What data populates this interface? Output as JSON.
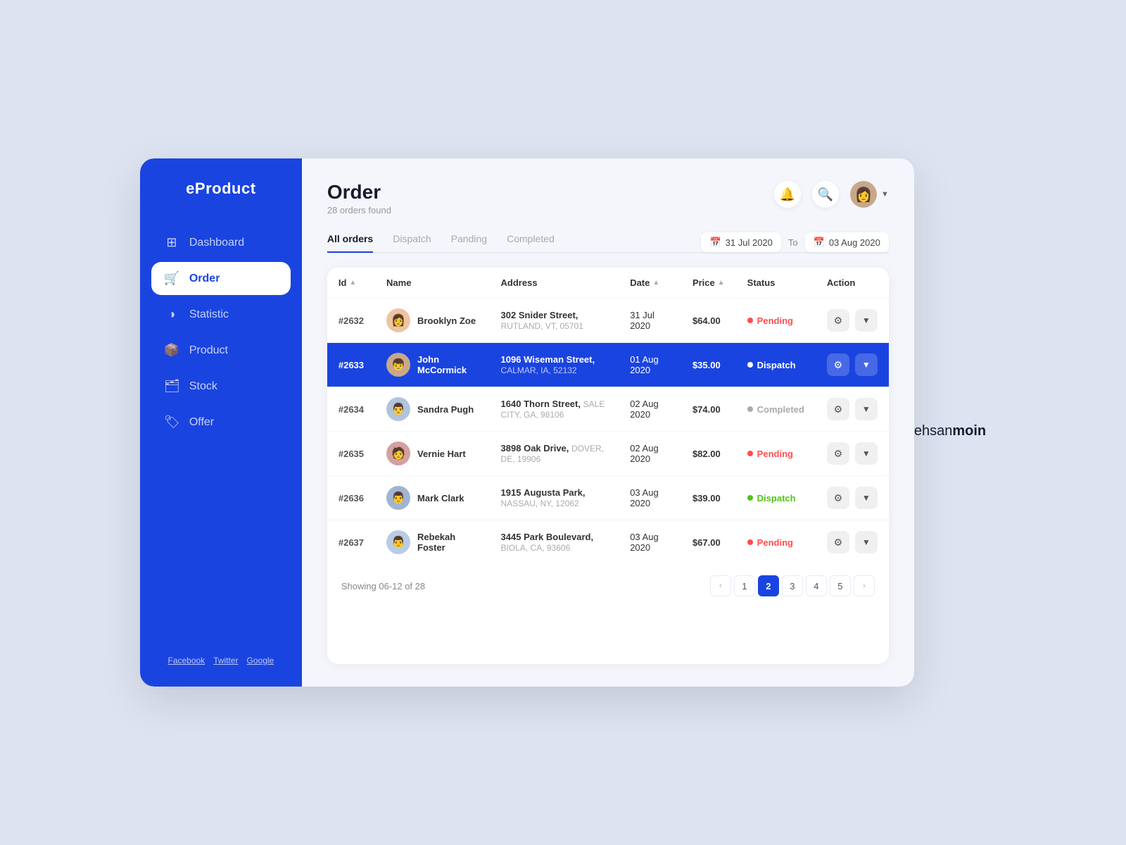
{
  "app": {
    "name": "eProduct"
  },
  "sidebar": {
    "logo": "eProduct",
    "nav_items": [
      {
        "id": "dashboard",
        "label": "Dashboard",
        "icon": "⊞",
        "active": false
      },
      {
        "id": "order",
        "label": "Order",
        "icon": "🛒",
        "active": true
      },
      {
        "id": "statistic",
        "label": "Statistic",
        "icon": "◑",
        "active": false
      },
      {
        "id": "product",
        "label": "Product",
        "icon": "📦",
        "active": false
      },
      {
        "id": "stock",
        "label": "Stock",
        "icon": "🗂",
        "active": false
      },
      {
        "id": "offer",
        "label": "Offer",
        "icon": "🏷",
        "active": false
      }
    ],
    "footer_links": [
      "Facebook",
      "Twitter",
      "Google"
    ]
  },
  "header": {
    "title": "Order",
    "subtitle": "28 orders found",
    "notification_icon": "🔔",
    "search_icon": "🔍"
  },
  "tabs": [
    {
      "id": "all",
      "label": "All orders",
      "active": true
    },
    {
      "id": "dispatch",
      "label": "Dispatch",
      "active": false
    },
    {
      "id": "pending",
      "label": "Panding",
      "active": false
    },
    {
      "id": "completed",
      "label": "Completed",
      "active": false
    }
  ],
  "date_range": {
    "from": "31 Jul 2020",
    "to": "03 Aug 2020",
    "separator": "To",
    "calendar_icon": "📅"
  },
  "table": {
    "columns": [
      {
        "key": "id",
        "label": "Id",
        "sortable": true
      },
      {
        "key": "name",
        "label": "Name",
        "sortable": false
      },
      {
        "key": "address",
        "label": "Address",
        "sortable": false
      },
      {
        "key": "date",
        "label": "Date",
        "sortable": true
      },
      {
        "key": "price",
        "label": "Price",
        "sortable": true
      },
      {
        "key": "status",
        "label": "Status",
        "sortable": false
      },
      {
        "key": "action",
        "label": "Action",
        "sortable": false
      }
    ],
    "rows": [
      {
        "id": "#2632",
        "name": "Brooklyn Zoe",
        "avatar_emoji": "👩",
        "avatar_bg": "#f0c4a0",
        "address_num": "302",
        "address_street": "Snider Street,",
        "address_city": "RUTLAND, VT, 05701",
        "date": "31 Jul 2020",
        "price": "$64.00",
        "status": "Pending",
        "status_type": "pending",
        "highlighted": false
      },
      {
        "id": "#2633",
        "name": "John McCormick",
        "avatar_emoji": "👦",
        "avatar_bg": "#c9a88a",
        "address_num": "1096",
        "address_street": "Wiseman Street,",
        "address_city": "CALMAR, IA, 52132",
        "date": "01 Aug 2020",
        "price": "$35.00",
        "status": "Dispatch",
        "status_type": "dispatch",
        "highlighted": true
      },
      {
        "id": "#2634",
        "name": "Sandra Pugh",
        "avatar_emoji": "👨",
        "avatar_bg": "#b0c4de",
        "address_num": "1640",
        "address_street": "Thorn Street,",
        "address_city": "SALE CITY, GA, 98106",
        "date": "02 Aug 2020",
        "price": "$74.00",
        "status": "Completed",
        "status_type": "completed",
        "highlighted": false
      },
      {
        "id": "#2635",
        "name": "Vernie Hart",
        "avatar_emoji": "🧑",
        "avatar_bg": "#d4a0a0",
        "address_num": "3898",
        "address_street": "Oak Drive,",
        "address_city": "DOVER, DE, 19906",
        "date": "02 Aug 2020",
        "price": "$82.00",
        "status": "Pending",
        "status_type": "pending",
        "highlighted": false
      },
      {
        "id": "#2636",
        "name": "Mark Clark",
        "avatar_emoji": "👨",
        "avatar_bg": "#a0b4d4",
        "address_num": "1915",
        "address_street": "Augusta Park,",
        "address_city": "NASSAU, NY, 12062",
        "date": "03 Aug 2020",
        "price": "$39.00",
        "status": "Dispatch",
        "status_type": "dispatch",
        "highlighted": false
      },
      {
        "id": "#2637",
        "name": "Rebekah Foster",
        "avatar_emoji": "👨",
        "avatar_bg": "#b8cce4",
        "address_num": "3445",
        "address_street": "Park Boulevard,",
        "address_city": "BIOLA, CA, 93606",
        "date": "03 Aug 2020",
        "price": "$67.00",
        "status": "Pending",
        "status_type": "pending",
        "highlighted": false
      }
    ]
  },
  "pagination": {
    "showing": "Showing 06-12 of 28",
    "pages": [
      1,
      2,
      3,
      4,
      5
    ],
    "active_page": 2
  },
  "brand": {
    "light": "ehsan",
    "bold": "moin"
  }
}
